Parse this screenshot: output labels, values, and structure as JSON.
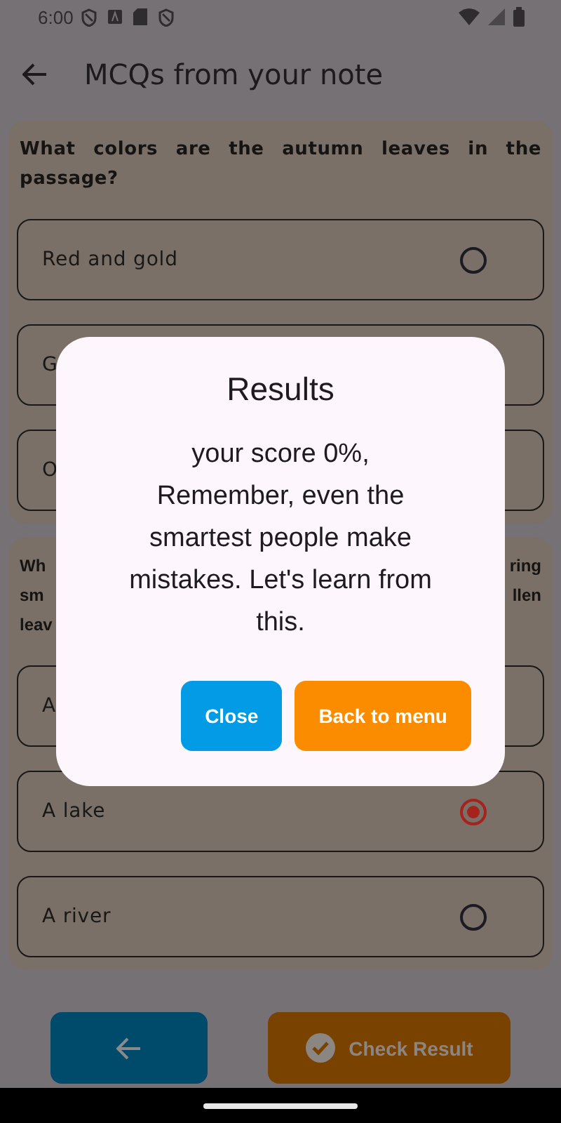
{
  "status_bar": {
    "time": "6:00"
  },
  "app_bar": {
    "title": "MCQs from your note"
  },
  "questions": [
    {
      "kind": "full",
      "text": "What colors are the autumn leaves in the passage?",
      "options": [
        {
          "label": "Red and gold",
          "selected": false
        },
        {
          "label": "G"
        },
        {
          "label": "O"
        }
      ]
    },
    {
      "kind": "fragments",
      "lines": [
        {
          "left": "Wh",
          "right": "ring"
        },
        {
          "left": "sm",
          "right": "llen"
        },
        {
          "left": "leav"
        }
      ],
      "options": [
        {
          "label": "A"
        },
        {
          "label": "A lake",
          "selected": true
        },
        {
          "label": "A river",
          "selected": false
        }
      ]
    }
  ],
  "bottom_buttons": [
    {
      "kind": "back"
    },
    {
      "kind": "check",
      "label": "Check Result"
    }
  ],
  "dialog": {
    "title": "Results",
    "message": "your score 0%,\nRemember, even the smartest people make mistakes. Let's learn from this.",
    "buttons": [
      {
        "label": "Close",
        "color": "#039be5"
      },
      {
        "label": "Back to menu",
        "color": "#fb8c00"
      }
    ]
  }
}
